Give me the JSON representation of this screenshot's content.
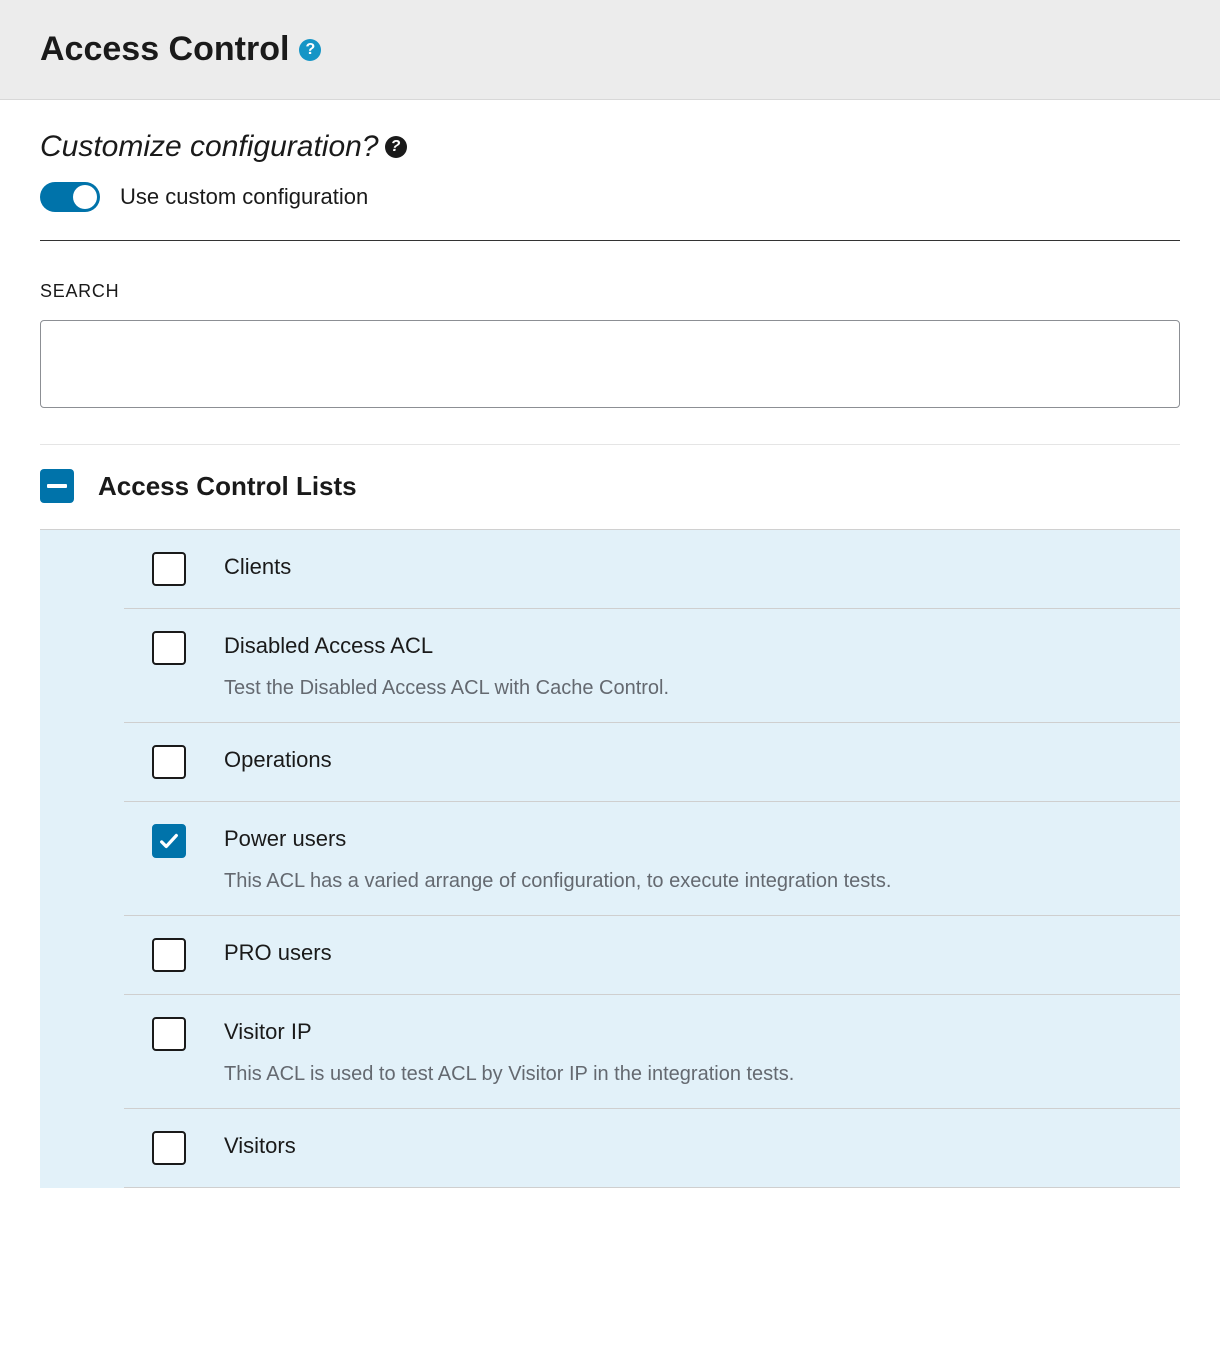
{
  "header": {
    "title": "Access Control"
  },
  "customize": {
    "heading": "Customize configuration?",
    "toggle_label": "Use custom configuration",
    "enabled": true
  },
  "search": {
    "label": "SEARCH",
    "value": ""
  },
  "group": {
    "title": "Access Control Lists",
    "state": "indeterminate",
    "items": [
      {
        "label": "Clients",
        "checked": false,
        "description": ""
      },
      {
        "label": "Disabled Access ACL",
        "checked": false,
        "description": "Test the Disabled Access ACL with Cache Control."
      },
      {
        "label": "Operations",
        "checked": false,
        "description": ""
      },
      {
        "label": "Power users",
        "checked": true,
        "description": "This ACL has a varied arrange of configuration, to execute integration tests."
      },
      {
        "label": "PRO users",
        "checked": false,
        "description": ""
      },
      {
        "label": "Visitor IP",
        "checked": false,
        "description": "This ACL is used to test ACL by Visitor IP in the integration tests."
      },
      {
        "label": "Visitors",
        "checked": false,
        "description": ""
      }
    ]
  }
}
